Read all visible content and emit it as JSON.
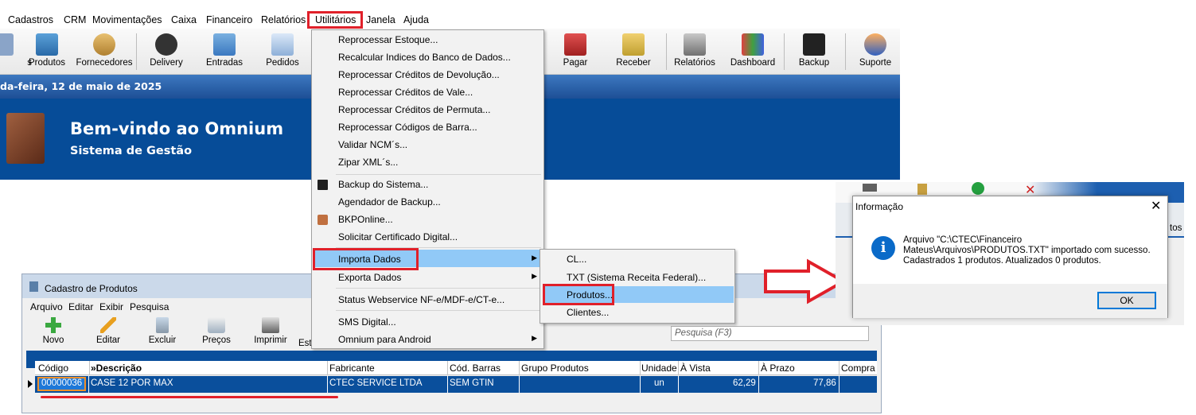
{
  "main_menu": [
    "Cadastros",
    "CRM",
    "Movimentações",
    "Caixa",
    "Financeiro",
    "Relatórios",
    "Utilitários",
    "Janela",
    "Ajuda"
  ],
  "toolbar": {
    "partial": "s",
    "items": [
      "Produtos",
      "Fornecedores",
      "Delivery",
      "Entradas",
      "Pedidos",
      "Pagar",
      "Receber",
      "Relatórios",
      "Dashboard",
      "Backup",
      "Suporte"
    ]
  },
  "date_text": "da-feira, 12 de maio de 2025",
  "banner": {
    "title": "Bem-vindo ao Omnium",
    "subtitle": "Sistema de Gestão"
  },
  "utilitarios_menu": {
    "group1": [
      "Reprocessar Estoque...",
      "Recalcular Indices do Banco de Dados...",
      "Reprocessar Créditos de Devolução...",
      "Reprocessar Créditos de Vale...",
      "Reprocessar Créditos de Permuta...",
      "Reprocessar Códigos de Barra...",
      "Validar NCM´s...",
      "Zipar XML´s..."
    ],
    "group2": [
      "Backup do Sistema...",
      "Agendador de Backup...",
      "BKPOnline...",
      "Solicitar Certificado Digital..."
    ],
    "group3": [
      "Importa Dados",
      "Exporta Dados"
    ],
    "group4": [
      "Status Webservice NF-e/MDF-e/CT-e..."
    ],
    "group5": [
      "SMS Digital...",
      "Omnium para Android"
    ]
  },
  "importa_submenu": [
    "CL...",
    "TXT (Sistema Receita Federal)...",
    "Produtos...",
    "Clientes..."
  ],
  "product_window": {
    "title": "Cadastro de Produtos",
    "menu": [
      "Arquivo",
      "Editar",
      "Exibir",
      "Pesquisa"
    ],
    "tools": [
      "Novo",
      "Editar",
      "Excluir",
      "Preços",
      "Imprimir",
      "Est"
    ],
    "search_placeholder": "Pesquisa (F3)",
    "columns": [
      "Código",
      "»Descrição",
      "Fabricante",
      "Cód. Barras",
      "Grupo Produtos",
      "Unidade",
      "À Vista",
      "À Prazo",
      "Compra"
    ],
    "row": {
      "codigo": "00000036",
      "descricao": "CASE 12 POR MAX",
      "fabricante": "CTEC SERVICE LTDA",
      "cod_barras": "SEM GTIN",
      "grupo": "",
      "unidade": "un",
      "a_vista": "62,29",
      "a_prazo": "77,86",
      "compra": ""
    }
  },
  "dialog": {
    "title": "Informação",
    "lines": [
      "Arquivo \"C:\\CTEC\\Financeiro",
      "Mateus\\Arquivos\\PRODUTOS.TXT\" importado com sucesso.",
      "Cadastrados 1 produtos. Atualizados 0 produtos."
    ],
    "ok": "OK",
    "bg_fragment": "tos"
  },
  "colors": {
    "highlight_red": "#e0202a",
    "menu_highlight": "#91c9f7",
    "banner_blue": "#064c98"
  }
}
